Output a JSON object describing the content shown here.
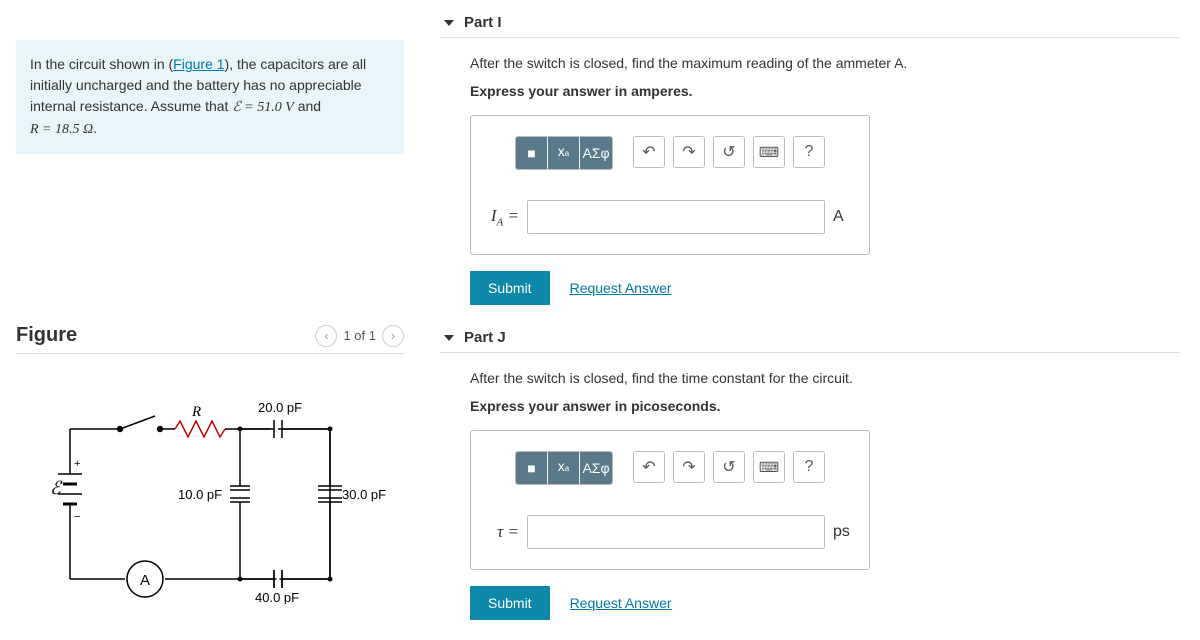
{
  "problem": {
    "intro_a": "In the circuit shown in (",
    "fig_link": "Figure 1",
    "intro_b": "), the capacitors are all initially uncharged and the battery has no appreciable internal resistance. Assume that ",
    "emf_expr": "ℰ = 51.0 V",
    "and": " and ",
    "r_expr": "R = 18.5 Ω",
    "period": "."
  },
  "figure": {
    "title": "Figure",
    "pager": "1 of 1",
    "labels": {
      "R": "R",
      "c20": "20.0 pF",
      "c10": "10.0 pF",
      "c30": "30.0 pF",
      "c40": "40.0 pF",
      "emf": "ℰ",
      "A": "A"
    }
  },
  "partI": {
    "title": "Part I",
    "question": "After the switch is closed, find the maximum reading of the ammeter A.",
    "instruction": "Express your answer in amperes.",
    "var": "I",
    "sub": "A",
    "eq": " =",
    "unit": "A",
    "submit": "Submit",
    "request": "Request Answer",
    "help": "?"
  },
  "partJ": {
    "title": "Part J",
    "question": "After the switch is closed, find the time constant for the circuit.",
    "instruction": "Express your answer in picoseconds.",
    "var": "τ",
    "eq": " =",
    "unit": "ps",
    "submit": "Submit",
    "request": "Request Answer",
    "help": "?"
  },
  "toolbar": {
    "tmpl": "■",
    "frac": "√",
    "sigma": "ΑΣφ"
  }
}
